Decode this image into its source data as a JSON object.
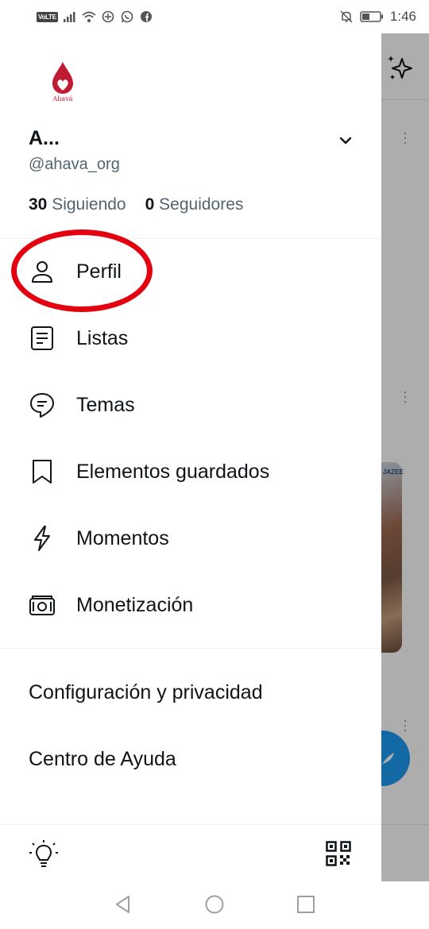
{
  "status_bar": {
    "volte": "VoLTE",
    "time": "1:46"
  },
  "account": {
    "logo_text": "Ahavá",
    "display_name": "A...",
    "handle": "@ahava_org",
    "following_count": "30",
    "following_label": "Siguiendo",
    "followers_count": "0",
    "followers_label": "Seguidores"
  },
  "menu": [
    {
      "label": "Perfil",
      "icon": "person-icon"
    },
    {
      "label": "Listas",
      "icon": "list-icon"
    },
    {
      "label": "Temas",
      "icon": "topics-icon"
    },
    {
      "label": "Elementos guardados",
      "icon": "bookmark-icon"
    },
    {
      "label": "Momentos",
      "icon": "lightning-icon"
    },
    {
      "label": "Monetización",
      "icon": "money-icon"
    }
  ],
  "secondary_menu": [
    {
      "label": "Configuración y privacidad"
    },
    {
      "label": "Centro de Ayuda"
    }
  ],
  "background": {
    "card_tag": "JAZEE"
  },
  "colors": {
    "annotation": "#e3000f",
    "primary_text": "#0f1419",
    "secondary_text": "#536471",
    "accent": "#1d9bf0",
    "brand": "#c01a34"
  }
}
